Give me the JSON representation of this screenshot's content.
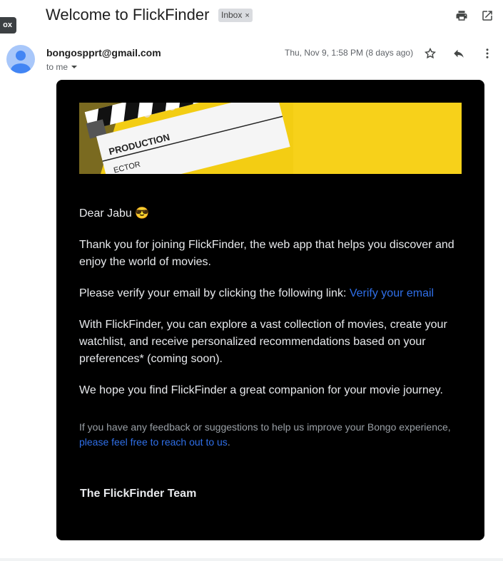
{
  "tooltip": "ox",
  "subject": "Welcome to FlickFinder",
  "label": {
    "text": "Inbox",
    "close": "×"
  },
  "sender": {
    "email": "bongospprt@gmail.com",
    "to_label": "to me",
    "date": "Thu, Nov 9, 1:58 PM (8 days ago)"
  },
  "icons": {
    "print": "printer-icon",
    "open_new": "open-in-new-window-icon",
    "star": "star-icon",
    "reply": "reply-icon",
    "more": "more-vert-icon",
    "avatar": "person-avatar-icon",
    "dropdown": "caret-down-icon"
  },
  "banner": {
    "slate_text_1": "PRODUCTION",
    "slate_text_2": "ECTOR"
  },
  "body": {
    "greeting": "Dear Jabu",
    "greeting_emoji": "😎",
    "p1": "Thank you for joining FlickFinder, the web app that helps you discover and enjoy the world of movies.",
    "p2_prefix": "Please verify your email by clicking the following link: ",
    "p2_link": "Verify your email",
    "p3": "With FlickFinder, you can explore a vast collection of movies, create your watchlist, and receive personalized recommendations based on your preferences* (coming soon).",
    "p4": "We hope you find FlickFinder a great companion for your movie journey.",
    "feedback_text": "If you have any feedback or suggestions to help us improve your Bongo experience, ",
    "feedback_link": "please feel free to reach out to us",
    "feedback_end": ".",
    "signature": "The FlickFinder Team"
  },
  "colors": {
    "card_bg": "#000000",
    "link": "#2f6fe8",
    "banner_yellow": "#f3cd13"
  }
}
